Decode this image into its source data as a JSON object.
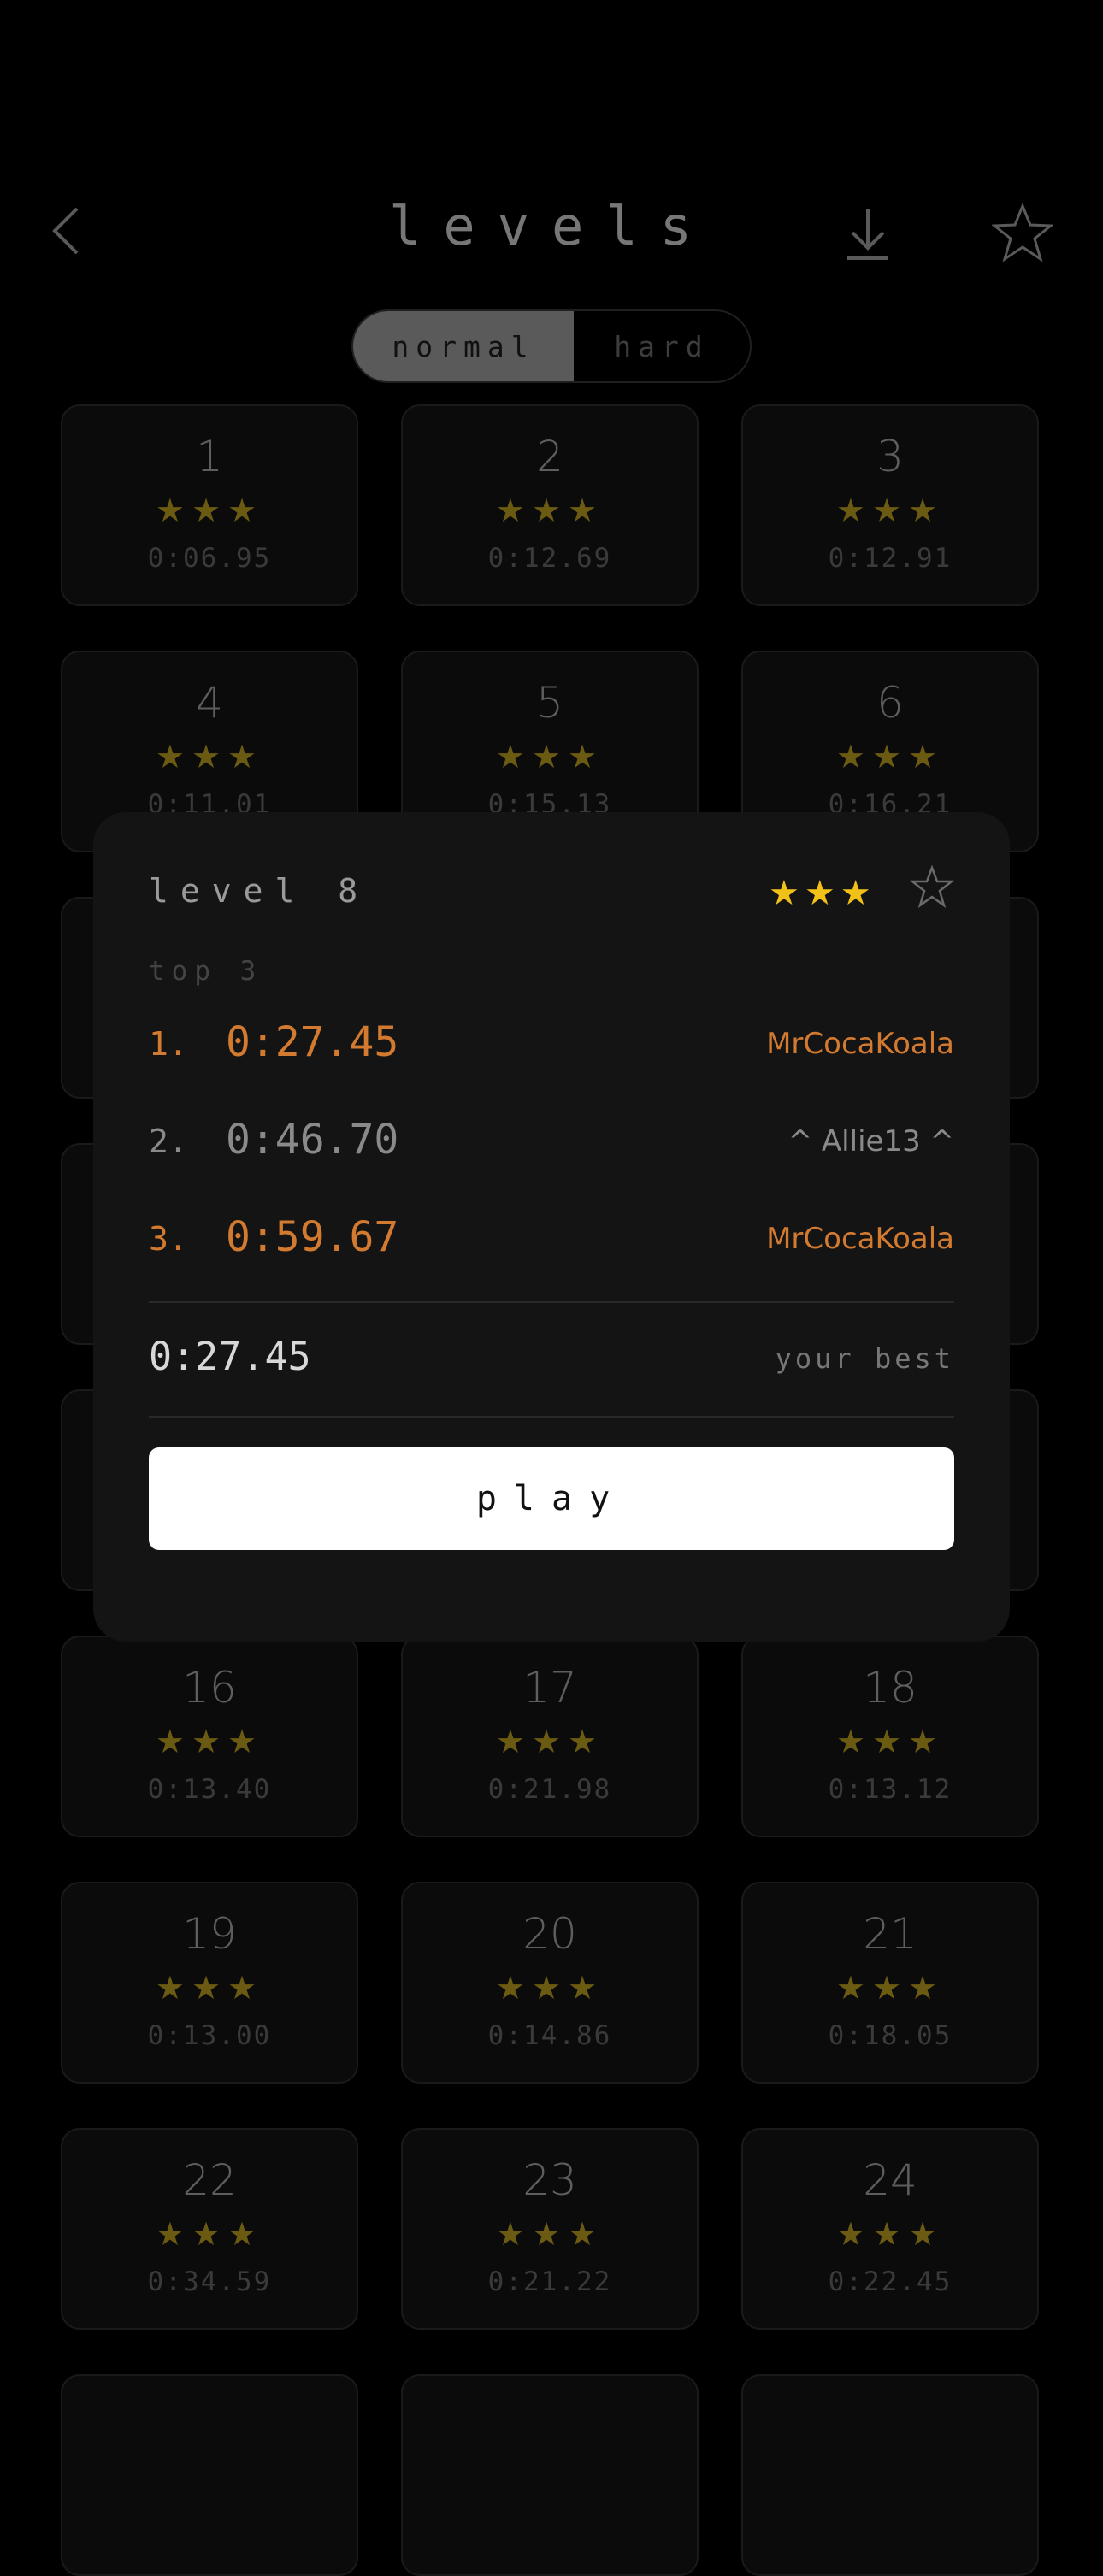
{
  "header": {
    "title": "levels"
  },
  "mode_tabs": [
    {
      "label": "normal",
      "selected": true
    },
    {
      "label": "hard",
      "selected": false
    }
  ],
  "levels": [
    {
      "number": "1",
      "stars": "★★★",
      "time": "0:06.95"
    },
    {
      "number": "2",
      "stars": "★★★",
      "time": "0:12.69"
    },
    {
      "number": "3",
      "stars": "★★★",
      "time": "0:12.91"
    },
    {
      "number": "4",
      "stars": "★★★",
      "time": "0:11.01"
    },
    {
      "number": "5",
      "stars": "★★★",
      "time": "0:15.13"
    },
    {
      "number": "6",
      "stars": "★★★",
      "time": "0:16.21"
    },
    {
      "number": "16",
      "stars": "★★★",
      "time": "0:13.40"
    },
    {
      "number": "17",
      "stars": "★★★",
      "time": "0:21.98"
    },
    {
      "number": "18",
      "stars": "★★★",
      "time": "0:13.12"
    },
    {
      "number": "19",
      "stars": "★★★",
      "time": "0:13.00"
    },
    {
      "number": "20",
      "stars": "★★★",
      "time": "0:14.86"
    },
    {
      "number": "21",
      "stars": "★★★",
      "time": "0:18.05"
    },
    {
      "number": "22",
      "stars": "★★★",
      "time": "0:34.59"
    },
    {
      "number": "23",
      "stars": "★★★",
      "time": "0:21.22"
    },
    {
      "number": "24",
      "stars": "★★★",
      "time": "0:22.45"
    }
  ],
  "modal": {
    "title": "level 8",
    "stars": "★★★",
    "top3_label": "top 3",
    "leaderboard": [
      {
        "rank": "1.",
        "time": "0:27.45",
        "name": "MrCocaKoala"
      },
      {
        "rank": "2.",
        "time": "0:46.70",
        "name": "^ Allie13 ^"
      },
      {
        "rank": "3.",
        "time": "0:59.67",
        "name": "MrCocaKoala"
      }
    ],
    "best_time": "0:27.45",
    "best_label": "your best",
    "play_label": "play"
  },
  "colors": {
    "accent": "#d27a30",
    "star_active": "#f2c118",
    "star_dim": "#6b5a12",
    "play_button": "#ffffff"
  }
}
